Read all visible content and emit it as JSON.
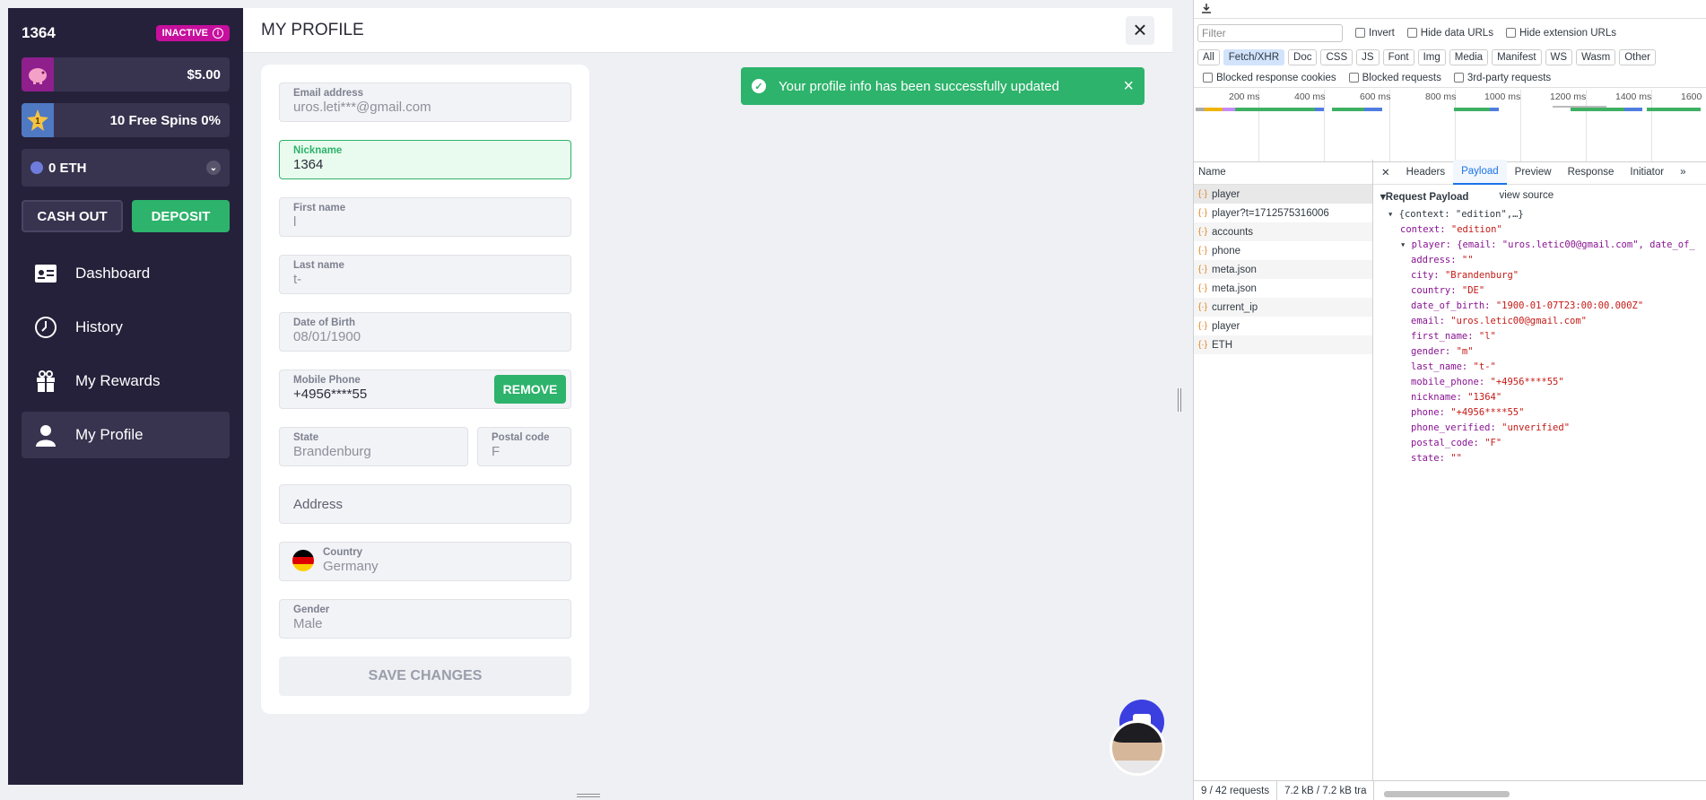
{
  "sidebar": {
    "user_id": "1364",
    "status_badge": "INACTIVE",
    "balance": "$5.00",
    "free_spins": "10 Free Spins 0%",
    "level": "1",
    "currency": "0 ETH",
    "cash_out": "CASH OUT",
    "deposit": "DEPOSIT",
    "nav": [
      {
        "label": "Dashboard",
        "icon": "dashboard-icon"
      },
      {
        "label": "History",
        "icon": "clock-icon"
      },
      {
        "label": "My Rewards",
        "icon": "gift-icon"
      },
      {
        "label": "My Profile",
        "icon": "user-icon"
      }
    ]
  },
  "main": {
    "title": "MY PROFILE",
    "toast": "Your profile info has been successfully updated"
  },
  "form": {
    "email_label": "Email address",
    "email_value": "uros.leti***@gmail.com",
    "nickname_label": "Nickname",
    "nickname_value": "1364",
    "first_name_label": "First name",
    "first_name_value": "l",
    "last_name_label": "Last name",
    "last_name_value": "t-",
    "dob_label": "Date of Birth",
    "dob_value": "08/01/1900",
    "phone_label": "Mobile Phone",
    "phone_value": "+4956****55",
    "remove": "REMOVE",
    "state_label": "State",
    "state_value": "Brandenburg",
    "postal_label": "Postal code",
    "postal_value": "F",
    "address_placeholder": "Address",
    "country_label": "Country",
    "country_value": "Germany",
    "gender_label": "Gender",
    "gender_value": "Male",
    "save": "SAVE CHANGES"
  },
  "devtools": {
    "filter_placeholder": "Filter",
    "invert": "Invert",
    "hide_data_urls": "Hide data URLs",
    "hide_ext_urls": "Hide extension URLs",
    "type_filters": [
      "All",
      "Fetch/XHR",
      "Doc",
      "CSS",
      "JS",
      "Font",
      "Img",
      "Media",
      "Manifest",
      "WS",
      "Wasm",
      "Other"
    ],
    "blocked_cookies": "Blocked response cookies",
    "blocked_requests": "Blocked requests",
    "third_party": "3rd-party requests",
    "timeline_ticks": [
      "200 ms",
      "400 ms",
      "600 ms",
      "800 ms",
      "1000 ms",
      "1200 ms",
      "1400 ms",
      "1600"
    ],
    "name_header": "Name",
    "requests": [
      "player",
      "player?t=1712575316006",
      "accounts",
      "phone",
      "meta.json",
      "meta.json",
      "current_ip",
      "player",
      "ETH"
    ],
    "tabs": [
      "Headers",
      "Payload",
      "Preview",
      "Response",
      "Initiator"
    ],
    "payload_title": "Request Payload",
    "view_source": "view source",
    "root_line": "{context: \"edition\",…}",
    "context_key": "context:",
    "context_val": "\"edition\"",
    "player_line": "player: {email: \"uros.letic00@gmail.com\", date_of_",
    "payload_fields": [
      {
        "k": "address:",
        "v": "\"\""
      },
      {
        "k": "city:",
        "v": "\"Brandenburg\""
      },
      {
        "k": "country:",
        "v": "\"DE\""
      },
      {
        "k": "date_of_birth:",
        "v": "\"1900-01-07T23:00:00.000Z\""
      },
      {
        "k": "email:",
        "v": "\"uros.letic00@gmail.com\""
      },
      {
        "k": "first_name:",
        "v": "\"l\""
      },
      {
        "k": "gender:",
        "v": "\"m\""
      },
      {
        "k": "last_name:",
        "v": "\"t-\""
      },
      {
        "k": "mobile_phone:",
        "v": "\"+4956****55\""
      },
      {
        "k": "nickname:",
        "v": "\"1364\""
      },
      {
        "k": "phone:",
        "v": "\"+4956****55\""
      },
      {
        "k": "phone_verified:",
        "v": "\"unverified\""
      },
      {
        "k": "postal_code:",
        "v": "\"F\""
      },
      {
        "k": "state:",
        "v": "\"\""
      }
    ],
    "footer_requests": "9 / 42 requests",
    "footer_size": "7.2 kB / 7.2 kB tra"
  }
}
